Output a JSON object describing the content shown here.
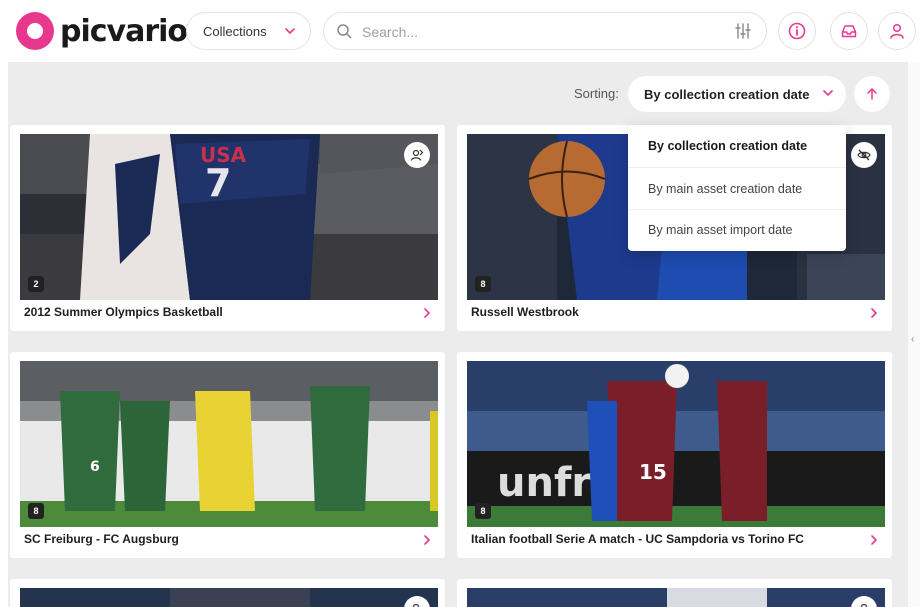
{
  "brand": {
    "name": "picvario",
    "accent": "#e8388e"
  },
  "header": {
    "collections_label": "Collections",
    "search_placeholder": "Search...",
    "icons": [
      "search-icon",
      "filter-sliders-icon",
      "info-icon",
      "inbox-icon",
      "user-icon"
    ]
  },
  "sorting": {
    "label": "Sorting:",
    "selected": "By collection creation date",
    "options": [
      "By collection creation date",
      "By main asset creation date",
      "By main asset import date"
    ],
    "direction_icon": "arrow-up-icon"
  },
  "cards": [
    {
      "title": "2012 Summer Olympics Basketball",
      "count": "2",
      "corner_icon": "user-share-icon"
    },
    {
      "title": "Russell Westbrook",
      "count": "8",
      "corner_icon": "eye-off-icon"
    },
    {
      "title": "SC Freiburg - FC Augsburg",
      "count": "8",
      "corner_icon": ""
    },
    {
      "title": "Italian football Serie A match - UC Sampdoria vs Torino FC",
      "count": "8",
      "corner_icon": ""
    }
  ]
}
